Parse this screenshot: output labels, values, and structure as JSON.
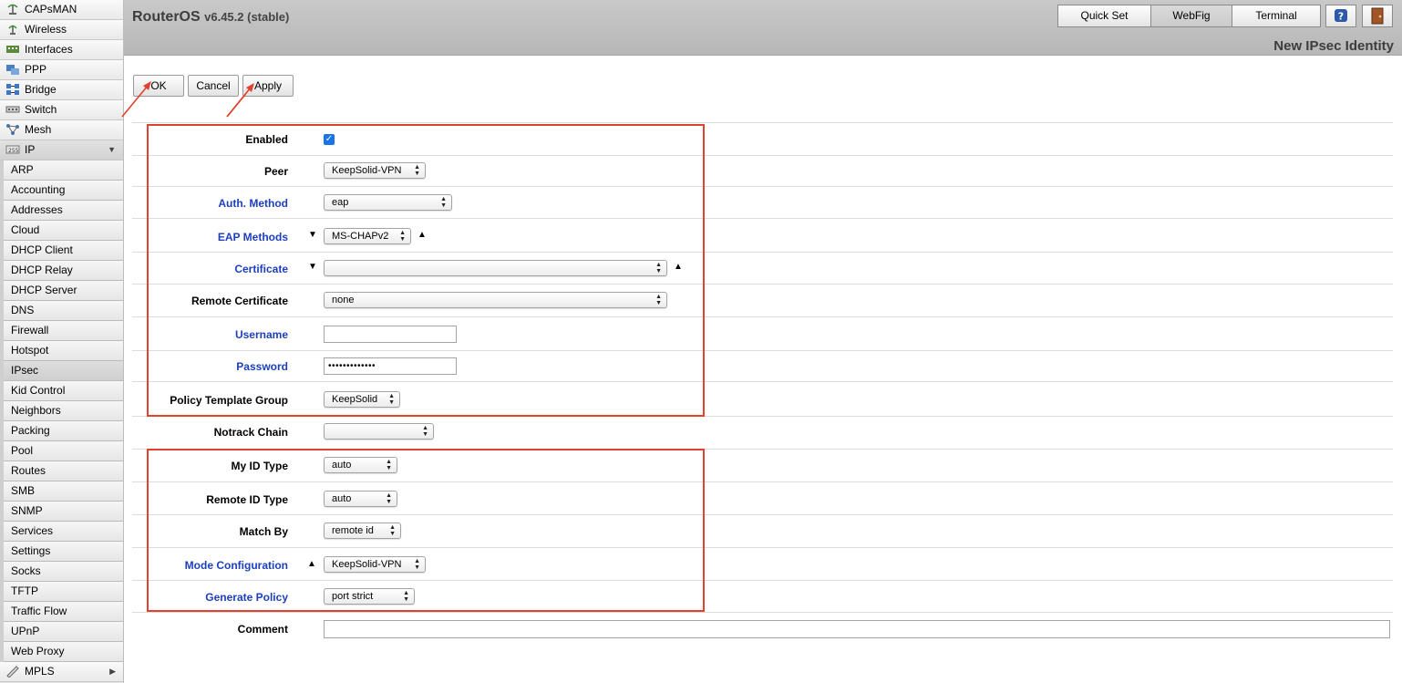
{
  "header": {
    "app_title": "RouterOS",
    "version": "v6.45.2 (stable)",
    "tabs": [
      "Quick Set",
      "WebFig",
      "Terminal"
    ],
    "active_tab": "WebFig",
    "page_heading": "New IPsec Identity"
  },
  "sidebar": {
    "top_items": [
      "CAPsMAN",
      "Wireless",
      "Interfaces",
      "PPP",
      "Bridge",
      "Switch",
      "Mesh"
    ],
    "ip_label": "IP",
    "ip_subitems": [
      "ARP",
      "Accounting",
      "Addresses",
      "Cloud",
      "DHCP Client",
      "DHCP Relay",
      "DHCP Server",
      "DNS",
      "Firewall",
      "Hotspot",
      "IPsec",
      "Kid Control",
      "Neighbors",
      "Packing",
      "Pool",
      "Routes",
      "SMB",
      "SNMP",
      "Services",
      "Settings",
      "Socks",
      "TFTP",
      "Traffic Flow",
      "UPnP",
      "Web Proxy"
    ],
    "active_subitem": "IPsec",
    "mpls_label": "MPLS"
  },
  "actions": {
    "ok": "OK",
    "cancel": "Cancel",
    "apply": "Apply"
  },
  "form": {
    "enabled": {
      "label": "Enabled",
      "checked": true
    },
    "peer": {
      "label": "Peer",
      "value": "KeepSolid-VPN"
    },
    "auth_method": {
      "label": "Auth. Method",
      "value": "eap"
    },
    "eap_methods": {
      "label": "EAP Methods",
      "value": "MS-CHAPv2"
    },
    "certificate": {
      "label": "Certificate",
      "value": ""
    },
    "remote_certificate": {
      "label": "Remote Certificate",
      "value": "none"
    },
    "username": {
      "label": "Username",
      "value": ""
    },
    "password": {
      "label": "Password",
      "value": "•••••••••••••"
    },
    "policy_template_group": {
      "label": "Policy Template Group",
      "value": "KeepSolid"
    },
    "notrack_chain": {
      "label": "Notrack Chain",
      "value": ""
    },
    "my_id_type": {
      "label": "My ID Type",
      "value": "auto"
    },
    "remote_id_type": {
      "label": "Remote ID Type",
      "value": "auto"
    },
    "match_by": {
      "label": "Match By",
      "value": "remote id"
    },
    "mode_configuration": {
      "label": "Mode Configuration",
      "value": "KeepSolid-VPN"
    },
    "generate_policy": {
      "label": "Generate Policy",
      "value": "port strict"
    },
    "comment": {
      "label": "Comment",
      "value": ""
    }
  },
  "colors": {
    "highlight_box": "#e0422d",
    "blue_label": "#1c3fbf",
    "checkbox": "#1a73e8"
  }
}
